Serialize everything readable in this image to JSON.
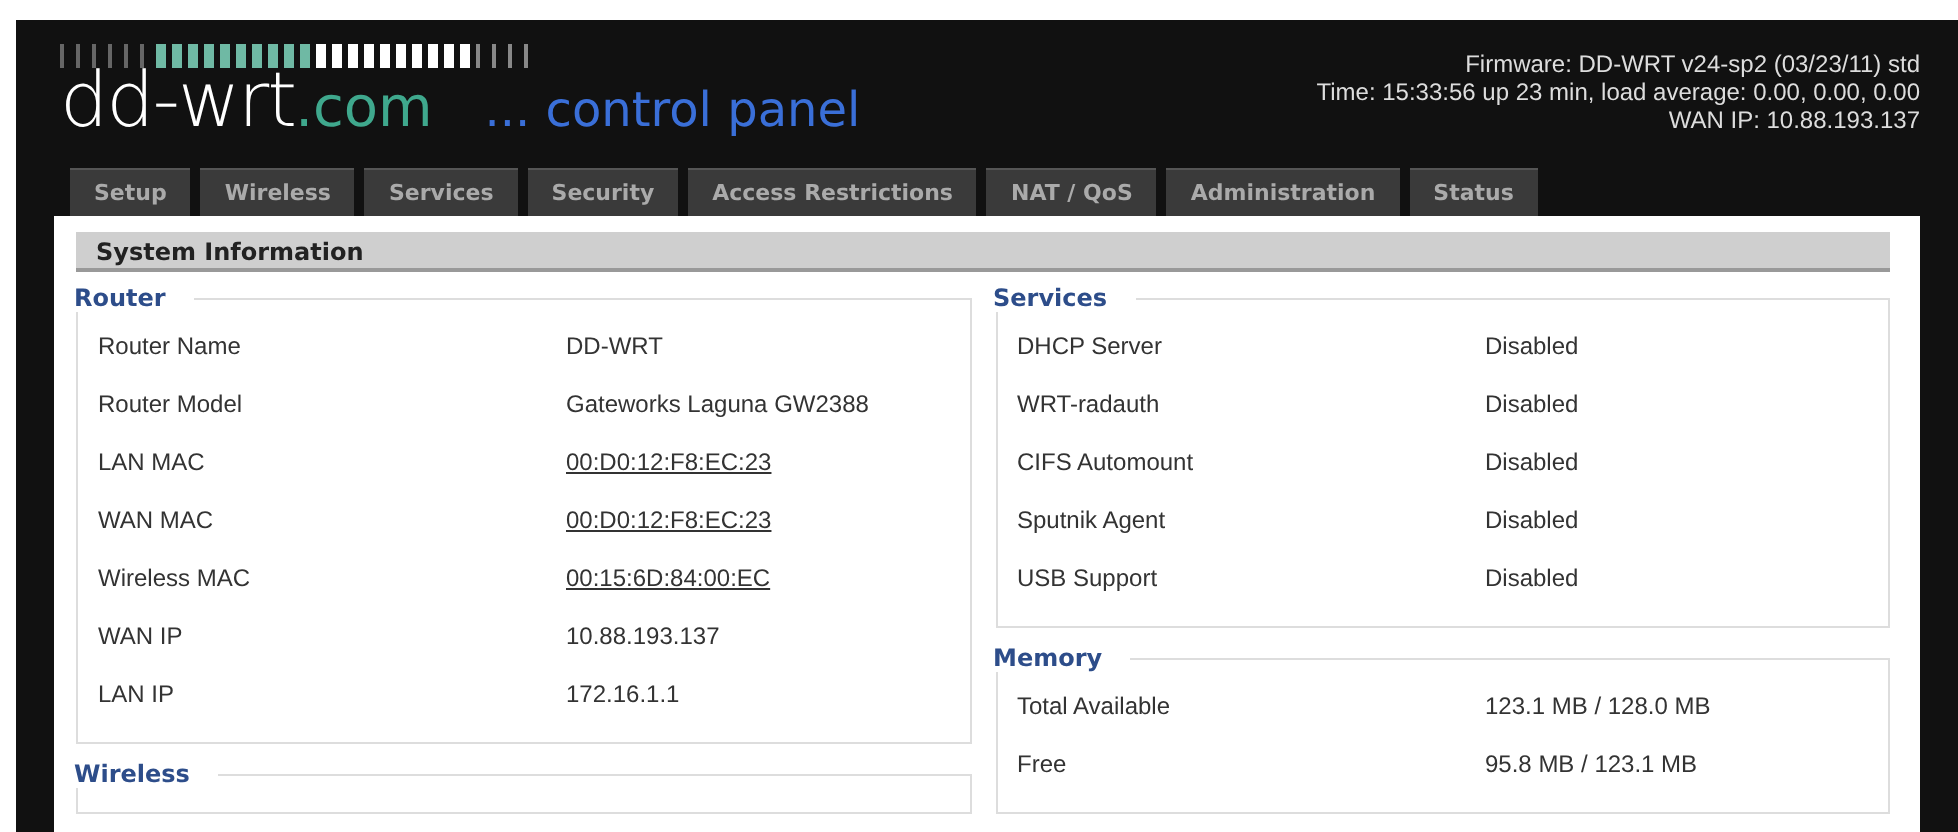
{
  "header": {
    "logo_name": "dd-wrt",
    "logo_domain": ".com",
    "subtitle": "... control panel",
    "info": [
      "Firmware: DD-WRT v24-sp2 (03/23/11) std",
      "Time: 15:33:56 up 23 min, load average: 0.00, 0.00, 0.00",
      "WAN IP: 10.88.193.137"
    ]
  },
  "tabs": [
    {
      "label": "Setup",
      "selected": false
    },
    {
      "label": "Wireless",
      "selected": false
    },
    {
      "label": "Services",
      "selected": false
    },
    {
      "label": "Security",
      "selected": false
    },
    {
      "label": "Access Restrictions",
      "selected": false
    },
    {
      "label": "NAT / QoS",
      "selected": false
    },
    {
      "label": "Administration",
      "selected": false
    },
    {
      "label": "Status",
      "selected": false
    }
  ],
  "section_title": "System Information",
  "left_groups": [
    {
      "legend": "Router",
      "rows": [
        {
          "label": "Router Name",
          "value": "DD-WRT",
          "kind": "text"
        },
        {
          "label": "Router Model",
          "value": "Gateworks Laguna GW2388",
          "kind": "text"
        },
        {
          "label": "LAN MAC",
          "value": "00:D0:12:F8:EC:23",
          "kind": "link"
        },
        {
          "label": "WAN MAC",
          "value": "00:D0:12:F8:EC:23",
          "kind": "link"
        },
        {
          "label": "Wireless MAC",
          "value": "00:15:6D:84:00:EC",
          "kind": "link"
        },
        {
          "label": "WAN IP",
          "value": "10.88.193.137",
          "kind": "text"
        },
        {
          "label": "LAN IP",
          "value": "172.16.1.1",
          "kind": "text"
        }
      ]
    },
    {
      "legend": "Wireless"
    }
  ],
  "right_groups": [
    {
      "legend": "Services",
      "rows": [
        {
          "label": "DHCP Server",
          "value": "Disabled",
          "kind": "text"
        },
        {
          "label": "WRT-radauth",
          "value": "Disabled",
          "kind": "text"
        },
        {
          "label": "CIFS Automount",
          "value": "Disabled",
          "kind": "text"
        },
        {
          "label": "Sputnik Agent",
          "value": "Disabled",
          "kind": "text"
        },
        {
          "label": "USB Support",
          "value": "Disabled",
          "kind": "text"
        }
      ]
    },
    {
      "legend": "Memory",
      "rows": [
        {
          "label": "Total Available",
          "value": "123.1 MB / 128.0 MB",
          "kind": "text"
        },
        {
          "label": "Free",
          "value": "95.8 MB / 123.1 MB",
          "kind": "text"
        }
      ]
    }
  ]
}
